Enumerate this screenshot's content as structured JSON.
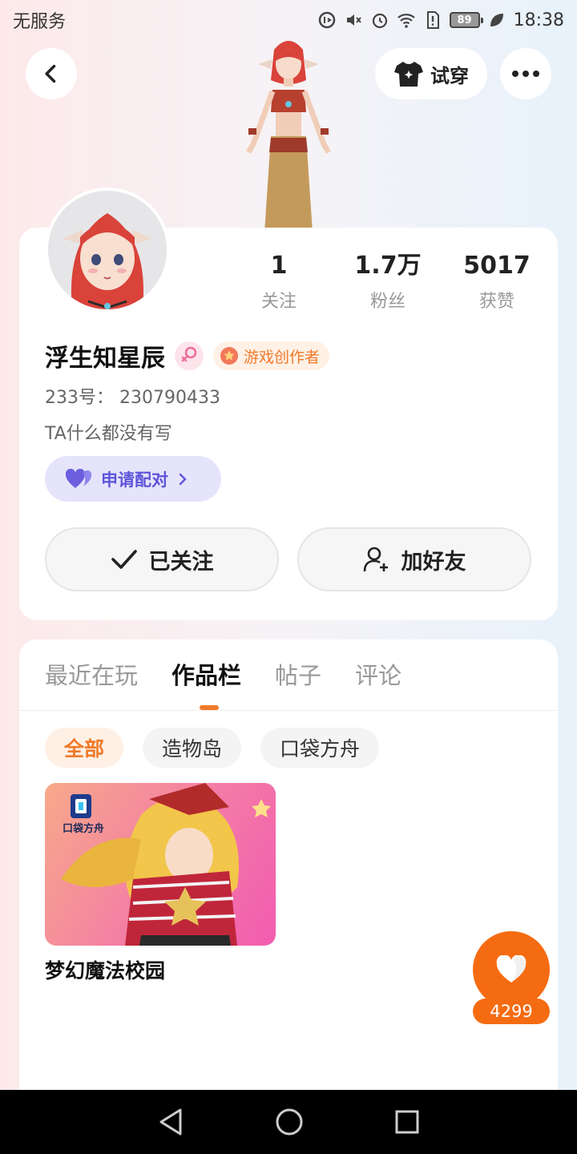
{
  "status_bar": {
    "carrier": "无服务",
    "battery": "89",
    "time": "18:38"
  },
  "header": {
    "tryon_label": "试穿"
  },
  "profile": {
    "username": "浮生知星辰",
    "creator_badge": "游戏创作者",
    "id_text": "233号：  230790433",
    "bio": "TA什么都没有写",
    "pair_label": "申请配对",
    "stats": [
      {
        "value": "1",
        "label": "关注"
      },
      {
        "value": "1.7万",
        "label": "粉丝"
      },
      {
        "value": "5017",
        "label": "获赞"
      }
    ],
    "followed_label": "已关注",
    "add_friend_label": "加好友"
  },
  "tabs": [
    "最近在玩",
    "作品栏",
    "帖子",
    "评论"
  ],
  "active_tab": "作品栏",
  "chips": [
    "全部",
    "造物岛",
    "口袋方舟"
  ],
  "works": [
    {
      "title": "梦幻魔法校园",
      "thumb_logo_text": "口袋方舟"
    }
  ],
  "like": {
    "count": "4299"
  },
  "colors": {
    "accent": "#f07a2a",
    "like": "#f56b12",
    "pair_bg": "#e6e4fb",
    "pair_text": "#5d55d9"
  }
}
